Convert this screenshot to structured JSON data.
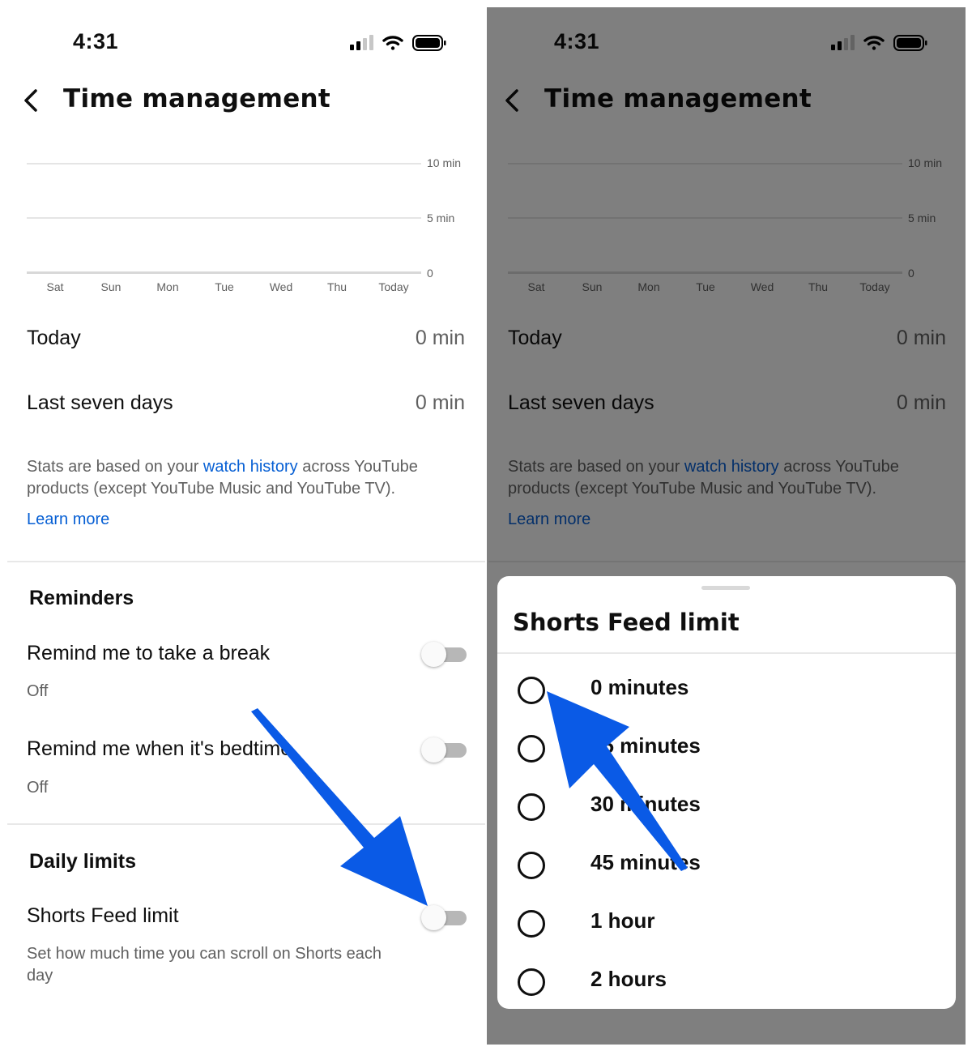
{
  "screen": {
    "time": "4:31",
    "page_title": "Time management"
  },
  "chart_data": {
    "type": "bar",
    "categories": [
      "Sat",
      "Sun",
      "Mon",
      "Tue",
      "Wed",
      "Thu",
      "Today"
    ],
    "values": [
      0,
      0,
      0,
      0,
      0,
      0,
      0
    ],
    "ytick_labels": [
      "10 min",
      "5 min",
      "0"
    ],
    "ylim": [
      0,
      10
    ]
  },
  "summary": {
    "today_label": "Today",
    "today_value": "0 min",
    "week_label": "Last seven days",
    "week_value": "0 min"
  },
  "stats_note": {
    "prefix": "Stats are based on your ",
    "link": "watch history",
    "suffix": " across YouTube products (except YouTube Music and YouTube TV).",
    "learn_more": "Learn more"
  },
  "reminders": {
    "title": "Reminders",
    "break_label": "Remind me to take a break",
    "break_status": "Off",
    "bedtime_label": "Remind me when it's bedtime",
    "bedtime_status": "Off"
  },
  "daily_limits": {
    "title": "Daily limits",
    "shorts_label": "Shorts Feed limit",
    "shorts_desc": "Set how much time you can scroll on Shorts each day"
  },
  "sheet": {
    "title": "Shorts Feed limit",
    "options": [
      "0 minutes",
      "15 minutes",
      "30 minutes",
      "45 minutes",
      "1 hour",
      "2 hours"
    ]
  },
  "colors": {
    "link": "#065fd4",
    "annotation_arrow": "#0a5ae6",
    "overlay": "rgba(0,0,0,0.5)"
  },
  "icons": [
    "back-arrow-icon",
    "cellular-signal-icon",
    "wifi-icon",
    "battery-icon",
    "annotation-arrow-icon"
  ]
}
